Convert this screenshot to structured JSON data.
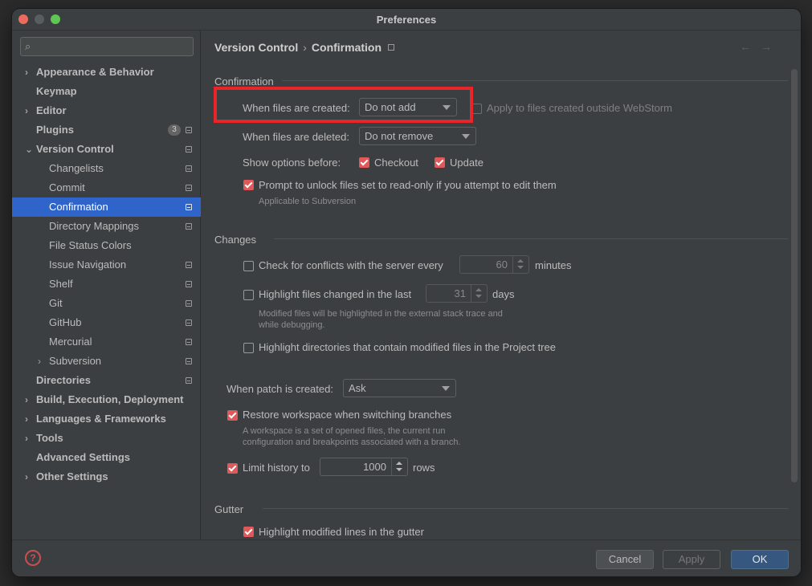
{
  "window": {
    "title": "Preferences"
  },
  "search": {
    "placeholder": ""
  },
  "sidebar": {
    "items": [
      {
        "label": "Appearance & Behavior",
        "level": 0,
        "arrow": "›",
        "bold": true
      },
      {
        "label": "Keymap",
        "level": 0,
        "bold": true
      },
      {
        "label": "Editor",
        "level": 0,
        "arrow": "›",
        "bold": true
      },
      {
        "label": "Plugins",
        "level": 0,
        "bold": true,
        "count": "3",
        "proj": true
      },
      {
        "label": "Version Control",
        "level": 0,
        "arrow": "⌄",
        "bold": true,
        "proj": true
      },
      {
        "label": "Changelists",
        "level": 1,
        "proj": true
      },
      {
        "label": "Commit",
        "level": 1,
        "proj": true
      },
      {
        "label": "Confirmation",
        "level": 1,
        "proj": true,
        "selected": true
      },
      {
        "label": "Directory Mappings",
        "level": 1,
        "proj": true
      },
      {
        "label": "File Status Colors",
        "level": 1
      },
      {
        "label": "Issue Navigation",
        "level": 1,
        "proj": true
      },
      {
        "label": "Shelf",
        "level": 1,
        "proj": true
      },
      {
        "label": "Git",
        "level": 1,
        "proj": true
      },
      {
        "label": "GitHub",
        "level": 1,
        "proj": true
      },
      {
        "label": "Mercurial",
        "level": 1,
        "proj": true
      },
      {
        "label": "Subversion",
        "level": 1,
        "arrow": "›",
        "proj": true
      },
      {
        "label": "Directories",
        "level": 0,
        "bold": true,
        "proj": true
      },
      {
        "label": "Build, Execution, Deployment",
        "level": 0,
        "arrow": "›",
        "bold": true
      },
      {
        "label": "Languages & Frameworks",
        "level": 0,
        "arrow": "›",
        "bold": true
      },
      {
        "label": "Tools",
        "level": 0,
        "arrow": "›",
        "bold": true
      },
      {
        "label": "Advanced Settings",
        "level": 0,
        "bold": true
      },
      {
        "label": "Other Settings",
        "level": 0,
        "arrow": "›",
        "bold": true
      }
    ]
  },
  "breadcrumb": {
    "parent": "Version Control",
    "separator": "›",
    "current": "Confirmation"
  },
  "nav": {
    "back": "←",
    "forward": "→"
  },
  "confirmation": {
    "title": "Confirmation",
    "created_label": "When files are created:",
    "created_value": "Do not add",
    "apply_outside_label": "Apply to files created outside WebStorm",
    "apply_outside_checked": false,
    "deleted_label": "When files are deleted:",
    "deleted_value": "Do not remove",
    "show_options_label": "Show options before:",
    "checkout_label": "Checkout",
    "update_label": "Update",
    "prompt_unlock_label": "Prompt to unlock files set to read-only if you attempt to edit them",
    "prompt_unlock_hint": "Applicable to Subversion"
  },
  "changes": {
    "title": "Changes",
    "conflicts_label": "Check for conflicts with the server every",
    "conflicts_value": "60",
    "conflicts_unit": "minutes",
    "highlight_changed_label": "Highlight files changed in the last",
    "highlight_changed_value": "31",
    "highlight_changed_unit": "days",
    "highlight_changed_hint_1": "Modified files will be highlighted in the external stack trace and",
    "highlight_changed_hint_2": "while debugging.",
    "highlight_dirs_label": "Highlight directories that contain modified files in the Project tree"
  },
  "patch": {
    "label": "When patch is created:",
    "value": "Ask"
  },
  "restore": {
    "label": "Restore workspace when switching branches",
    "hint_1": "A workspace is a set of opened files, the current run",
    "hint_2": "configuration and breakpoints associated with a branch."
  },
  "history": {
    "label": "Limit history to",
    "value": "1000",
    "unit": "rows"
  },
  "gutter": {
    "title": "Gutter",
    "highlight_label": "Highlight modified lines in the gutter"
  },
  "footer": {
    "help": "?",
    "cancel": "Cancel",
    "apply": "Apply",
    "ok": "OK"
  },
  "colors": {
    "accent": "#2f65ca",
    "checkbox_on": "#e0585a",
    "annotation": "#e8262a"
  }
}
